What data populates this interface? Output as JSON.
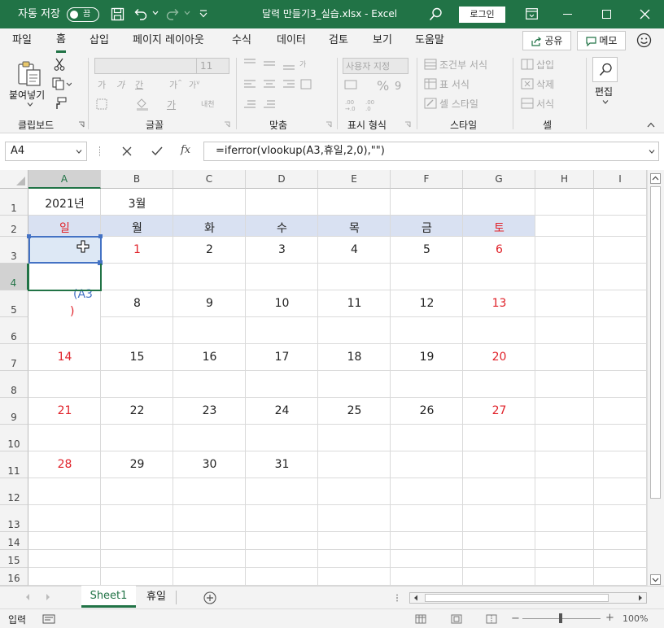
{
  "titlebar": {
    "autosave_label": "자동 저장",
    "autosave_state": "끔",
    "document_title": "달력 만들기3_실습.xlsx  -  Excel",
    "login_label": "로그인"
  },
  "menu": {
    "tabs": [
      "파일",
      "홈",
      "삽입",
      "페이지 레이아웃",
      "수식",
      "데이터",
      "검토",
      "보기",
      "도움말"
    ],
    "active_tab": "홈",
    "share_label": "공유",
    "comments_label": "메모"
  },
  "ribbon": {
    "clipboard": {
      "paste_label": "붙여넣기",
      "group_label": "클립보드"
    },
    "font": {
      "font_size": "11",
      "group_label": "글꼴",
      "grow_label": "가",
      "shrink_label": "가"
    },
    "alignment": {
      "group_label": "맞춤"
    },
    "number": {
      "format_value": "사용자 지정",
      "group_label": "표시 형식"
    },
    "styles": {
      "conditional_label": "조건부 서식",
      "table_label": "표 서식",
      "cell_styles_label": "셀 스타일",
      "group_label": "스타일"
    },
    "cells": {
      "insert_label": "삽입",
      "delete_label": "삭제",
      "format_label": "서식",
      "group_label": "셀"
    },
    "editing": {
      "label": "편집"
    }
  },
  "formula_bar": {
    "name_box": "A4",
    "formula": "=iferror(vlookup(A3,휴일,2,0),\"\")"
  },
  "grid": {
    "columns": [
      "A",
      "B",
      "C",
      "D",
      "E",
      "F",
      "G",
      "H",
      "I"
    ],
    "rows": [
      "1",
      "2",
      "3",
      "4",
      "5",
      "6",
      "7",
      "8",
      "9",
      "10",
      "11",
      "12",
      "13",
      "14",
      "15",
      "16"
    ],
    "title_cells": {
      "a1": "2021년",
      "b1": "3월"
    },
    "weekdays": [
      "일",
      "월",
      "화",
      "수",
      "목",
      "금",
      "토"
    ],
    "weeks": [
      [
        "",
        "1",
        "2",
        "3",
        "4",
        "5",
        "6"
      ],
      [
        "",
        "8",
        "9",
        "10",
        "11",
        "12",
        "13"
      ],
      [
        "14",
        "15",
        "16",
        "17",
        "18",
        "19",
        "20"
      ],
      [
        "21",
        "22",
        "23",
        "24",
        "25",
        "26",
        "27"
      ],
      [
        "28",
        "29",
        "30",
        "31",
        "",
        "",
        ""
      ]
    ],
    "edit_tooltip_line1": "(A3",
    "edit_tooltip_line2": ")"
  },
  "sheets": {
    "tabs": [
      "Sheet1",
      "휴일"
    ],
    "active": "Sheet1"
  },
  "status": {
    "mode": "입력",
    "zoom": "100%"
  },
  "colors": {
    "brand": "#217346",
    "weekday_header_bg": "#d9e1f2",
    "holiday_red": "#e0222a",
    "reference_blue": "#4472c4"
  }
}
